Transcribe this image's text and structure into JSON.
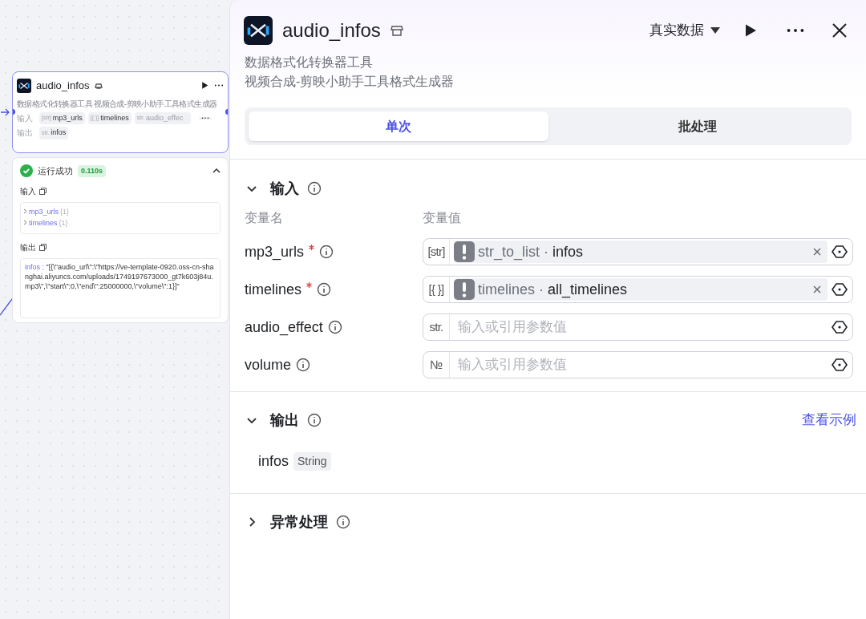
{
  "node": {
    "title": "audio_infos",
    "description": "数据格式化转换器工具 视频合成-剪映小助手工具格式生成器",
    "inputs_label": "输入",
    "inputs": [
      {
        "type_label": "[str]",
        "name": "mp3_urls"
      },
      {
        "type_label": "[{ }]",
        "name": "timelines"
      },
      {
        "type_label": "str.",
        "name": "audio_effec"
      }
    ],
    "outputs_label": "输出",
    "outputs": [
      {
        "type_label": "str.",
        "name": "infos"
      }
    ]
  },
  "run_result": {
    "status": "运行成功",
    "success": true,
    "duration": "0.110s",
    "expanded": true,
    "input_label": "输入",
    "input_items": [
      {
        "name": "mp3_urls",
        "count": "{1}"
      },
      {
        "name": "timelines",
        "count": "{1}"
      }
    ],
    "output_label": "输出",
    "output_key": "infos :",
    "output_value": "\"[{\\\"audio_url\\\":\\\"https://ve-template-0920.oss-cn-shanghai.aliyuncs.com/uploads/1749197673000_gt7k603j84u.mp3\\\",\\\"start\\\":0,\\\"end\\\":25000000,\\\"volume\\\":1}]\""
  },
  "panel": {
    "title": "audio_infos",
    "description": [
      "数据格式化转换器工具",
      "视频合成-剪映小助手工具格式生成器"
    ],
    "data_source": "真实数据",
    "tabs": [
      {
        "label": "单次",
        "selected": true
      },
      {
        "label": "批处理",
        "selected": false
      }
    ],
    "input_section": {
      "title": "输入",
      "expanded": true,
      "name_header": "变量名",
      "value_header": "变量值",
      "params": [
        {
          "name": "mp3_urls",
          "required": true,
          "type_label": "[str]",
          "kind": "reference",
          "reference": "str_to_list · **infos**"
        },
        {
          "name": "timelines",
          "required": true,
          "type_label": "[{ }]",
          "kind": "reference",
          "reference": "timelines · **all_timelines**"
        },
        {
          "name": "audio_effect",
          "required": false,
          "type_label": "str.",
          "kind": "empty",
          "placeholder": "输入或引用参数值"
        },
        {
          "name": "volume",
          "required": false,
          "type_label": "№",
          "kind": "empty",
          "placeholder": "输入或引用参数值"
        }
      ]
    },
    "output_section": {
      "title": "输出",
      "expanded": true,
      "example_link": "查看示例",
      "outputs": [
        {
          "name": "infos",
          "type": "String"
        }
      ]
    },
    "error_section": {
      "title": "异常处理",
      "expanded": false
    }
  }
}
